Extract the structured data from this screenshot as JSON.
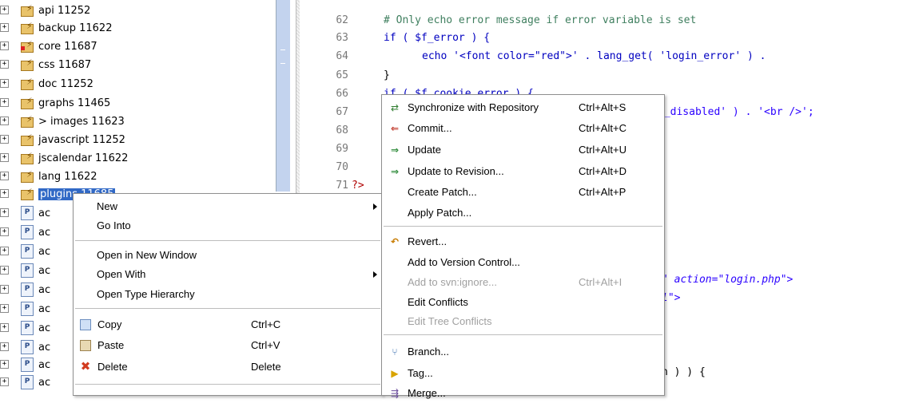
{
  "tree": {
    "folders": [
      {
        "label": "api 11252"
      },
      {
        "label": "backup 11622"
      },
      {
        "label": "core 11687"
      },
      {
        "label": "css 11687"
      },
      {
        "label": "doc 11252"
      },
      {
        "label": "graphs 11465"
      },
      {
        "label": "> images 11623"
      },
      {
        "label": "javascript 11252"
      },
      {
        "label": "jscalendar 11622"
      },
      {
        "label": "lang 11622"
      },
      {
        "label": "plugins 11685"
      }
    ],
    "files": [
      "ac",
      "ac",
      "ac",
      "ac",
      "ac",
      "ac",
      "ac",
      "ac",
      "ac",
      "ac"
    ],
    "expander_symbol": "+",
    "file_icon_letter": "P"
  },
  "editor": {
    "lines": [
      {
        "num": "62",
        "kind": "comment",
        "text": "# Only echo error message if error variable is set"
      },
      {
        "num": "63",
        "kind": "if1",
        "text": "if ( $f_error ) {"
      },
      {
        "num": "64",
        "kind": "echo",
        "text": "echo '<font color=\"red\">' . lang_get( 'login_error' ) ."
      },
      {
        "num": "65",
        "kind": "plain",
        "text": "}"
      },
      {
        "num": "66",
        "kind": "plain",
        "text": "if ( $f_cookie_error ) {"
      },
      {
        "num": "67",
        "kind": "str_tail",
        "text": "s_disabled' ) . '<br />';"
      },
      {
        "num": "68",
        "kind": "plain",
        "text": ""
      },
      {
        "num": "69",
        "kind": "plain",
        "text": ""
      },
      {
        "num": "70",
        "kind": "plain",
        "text": ""
      },
      {
        "num": "71",
        "kind": "php",
        "text": "?>"
      }
    ],
    "fragments": {
      "action": "\" action=\"login.php\">",
      "name_attr": "l\">",
      "brace": "n ) ) {"
    }
  },
  "main_menu": {
    "items": [
      {
        "label": "New",
        "submenu": true
      },
      {
        "label": "Go Into"
      },
      {
        "label": "Open in New Window"
      },
      {
        "label": "Open With",
        "submenu": true
      },
      {
        "label": "Open Type Hierarchy"
      },
      {
        "label": "Copy",
        "shortcut": "Ctrl+C",
        "icon": "copy-icon"
      },
      {
        "label": "Paste",
        "shortcut": "Ctrl+V",
        "icon": "paste-icon"
      },
      {
        "label": "Delete",
        "shortcut": "Delete",
        "icon": "delete-icon"
      }
    ]
  },
  "team_menu": {
    "items": [
      {
        "label": "Synchronize with Repository",
        "shortcut": "Ctrl+Alt+S",
        "icon": "synchronize-icon"
      },
      {
        "label": "Commit...",
        "shortcut": "Ctrl+Alt+C",
        "icon": "commit-icon"
      },
      {
        "label": "Update",
        "shortcut": "Ctrl+Alt+U",
        "icon": "update-icon"
      },
      {
        "label": "Update to Revision...",
        "shortcut": "Ctrl+Alt+D",
        "icon": "update-revision-icon"
      },
      {
        "label": "Create Patch...",
        "shortcut": "Ctrl+Alt+P"
      },
      {
        "label": "Apply Patch..."
      },
      {
        "label": "Revert...",
        "icon": "revert-icon"
      },
      {
        "label": "Add to Version Control..."
      },
      {
        "label": "Add to svn:ignore...",
        "shortcut": "Ctrl+Alt+I",
        "disabled": true
      },
      {
        "label": "Edit Conflicts"
      },
      {
        "label": "Edit Tree Conflicts",
        "disabled": true
      },
      {
        "label": "Branch...",
        "icon": "branch-icon"
      },
      {
        "label": "Tag...",
        "icon": "tag-icon"
      },
      {
        "label": "Merge...",
        "icon": "merge-icon"
      }
    ]
  },
  "colors": {
    "selection": "#3169c6",
    "comment": "#3f7f5f",
    "keyword": "#0000c0",
    "string": "#2a00ff",
    "disabled": "#a0a0a0"
  }
}
